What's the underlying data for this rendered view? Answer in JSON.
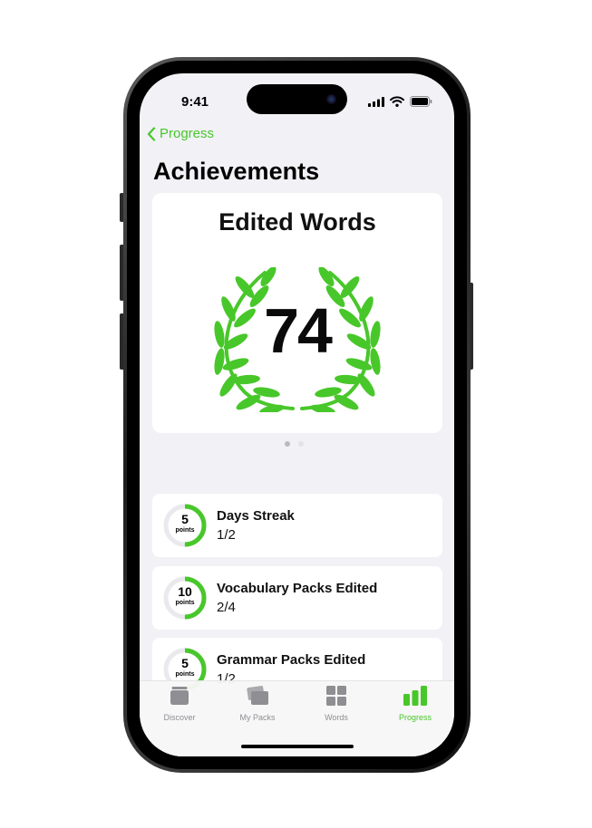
{
  "status_bar": {
    "time": "9:41",
    "icons": [
      "signal-icon",
      "wifi-icon",
      "battery-icon"
    ]
  },
  "nav": {
    "back_label": "Progress"
  },
  "page": {
    "title": "Achievements"
  },
  "hero": {
    "title": "Edited Words",
    "value": "74",
    "pager": {
      "count": 2,
      "active": 0
    }
  },
  "achievements": [
    {
      "points": "5",
      "unit": "points",
      "title": "Days Streak",
      "progress": "1/2",
      "fraction": 0.5
    },
    {
      "points": "10",
      "unit": "points",
      "title": "Vocabulary Packs Edited",
      "progress": "2/4",
      "fraction": 0.5
    },
    {
      "points": "5",
      "unit": "points",
      "title": "Grammar Packs Edited",
      "progress": "1/2",
      "fraction": 0.5
    }
  ],
  "tabs": [
    {
      "label": "Discover",
      "icon": "stack-icon",
      "active": false
    },
    {
      "label": "My Packs",
      "icon": "cards-icon",
      "active": false
    },
    {
      "label": "Words",
      "icon": "grid-icon",
      "active": false
    },
    {
      "label": "Progress",
      "icon": "bar-chart-icon",
      "active": true
    }
  ],
  "colors": {
    "accent": "#48c72a",
    "ring_track": "#e9e9ee",
    "background": "#f1f1f6"
  }
}
